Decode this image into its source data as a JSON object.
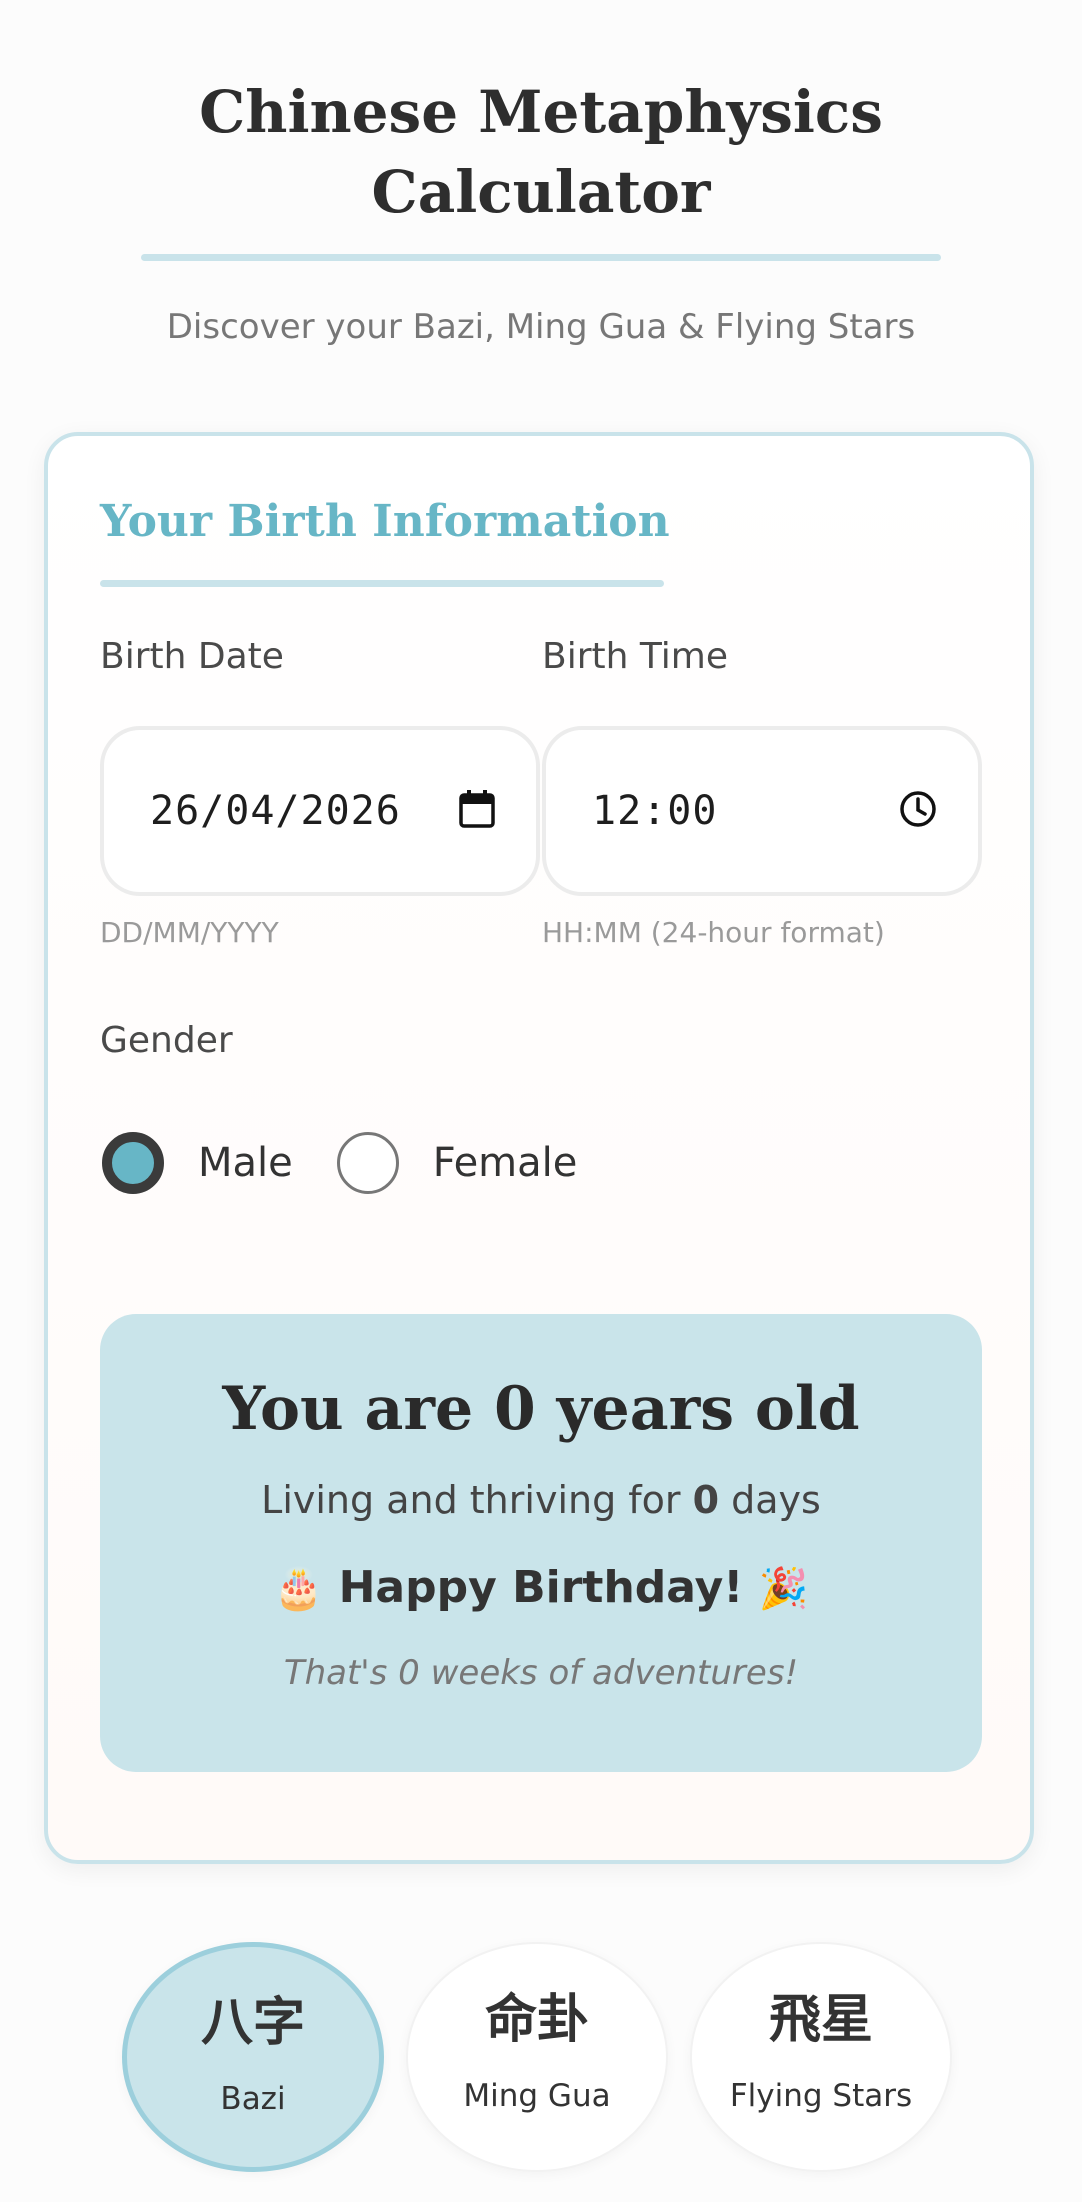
{
  "header": {
    "title": "Chinese Metaphysics Calculator",
    "subtitle": "Discover your Bazi, Ming Gua & Flying Stars"
  },
  "form": {
    "section_title": "Your Birth Information",
    "birth_date": {
      "label": "Birth Date",
      "value": "26/04/2026",
      "hint": "DD/MM/YYYY",
      "icon": "calendar-icon"
    },
    "birth_time": {
      "label": "Birth Time",
      "value": "12:00",
      "hint": "HH:MM (24-hour format)",
      "icon": "clock-icon"
    },
    "gender": {
      "label": "Gender",
      "options": [
        {
          "label": "Male",
          "selected": true
        },
        {
          "label": "Female",
          "selected": false
        }
      ]
    }
  },
  "age": {
    "headline": "You are 0 years old",
    "days_prefix": "Living and thriving for ",
    "days_value": "0",
    "days_suffix": " days",
    "birthday_emoji_left": "🎂",
    "birthday_text": "Happy Birthday!",
    "birthday_emoji_right": "🎉",
    "weeks_text": "That's 0 weeks of adventures!"
  },
  "tabs": [
    {
      "hanzi": "八字",
      "label": "Bazi",
      "active": true
    },
    {
      "hanzi": "命卦",
      "label": "Ming Gua",
      "active": false
    },
    {
      "hanzi": "飛星",
      "label": "Flying Stars",
      "active": false
    }
  ],
  "colors": {
    "accent": "#67b6c6",
    "accent_light": "#c9e4ea",
    "text": "#333333"
  }
}
